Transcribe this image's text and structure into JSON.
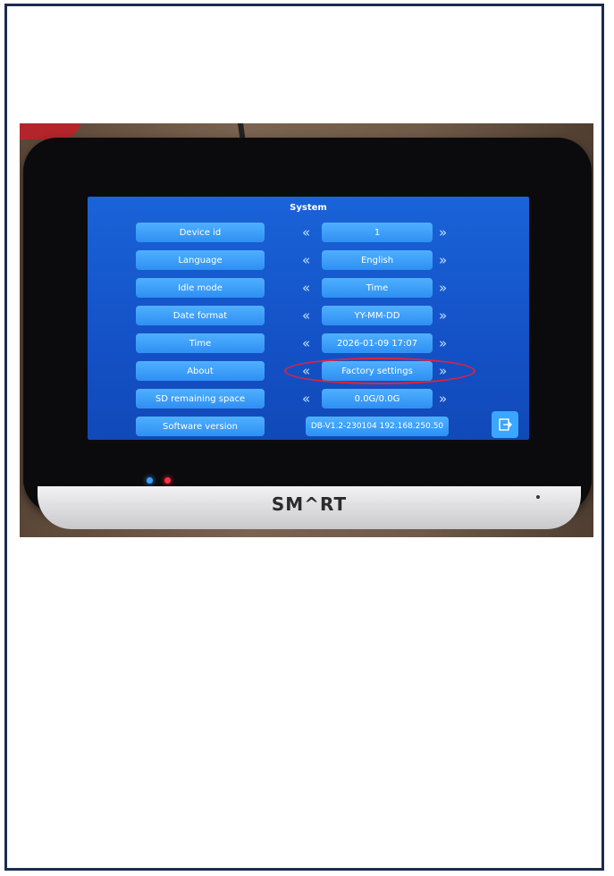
{
  "brand": "SM^RT",
  "screen": {
    "title": "System",
    "rows": [
      {
        "label": "Device id",
        "value": "1"
      },
      {
        "label": "Language",
        "value": "English"
      },
      {
        "label": "Idle mode",
        "value": "Time"
      },
      {
        "label": "Date format",
        "value": "YY-MM-DD"
      },
      {
        "label": "Time",
        "value": "2026-01-09 17:07"
      },
      {
        "label": "About",
        "value": "Factory settings"
      },
      {
        "label": "SD remaining space",
        "value": "0.0G/0.0G"
      },
      {
        "label": "Software version",
        "value": "DB-V1.2-230104  192.168.250.50"
      }
    ],
    "arrow_left": "«",
    "arrow_right": "»",
    "exit_icon": "exit-icon"
  },
  "colors": {
    "screen_blue": "#1451c7",
    "button_blue": "#2f8ff3",
    "highlight_red": "#e0243a"
  }
}
